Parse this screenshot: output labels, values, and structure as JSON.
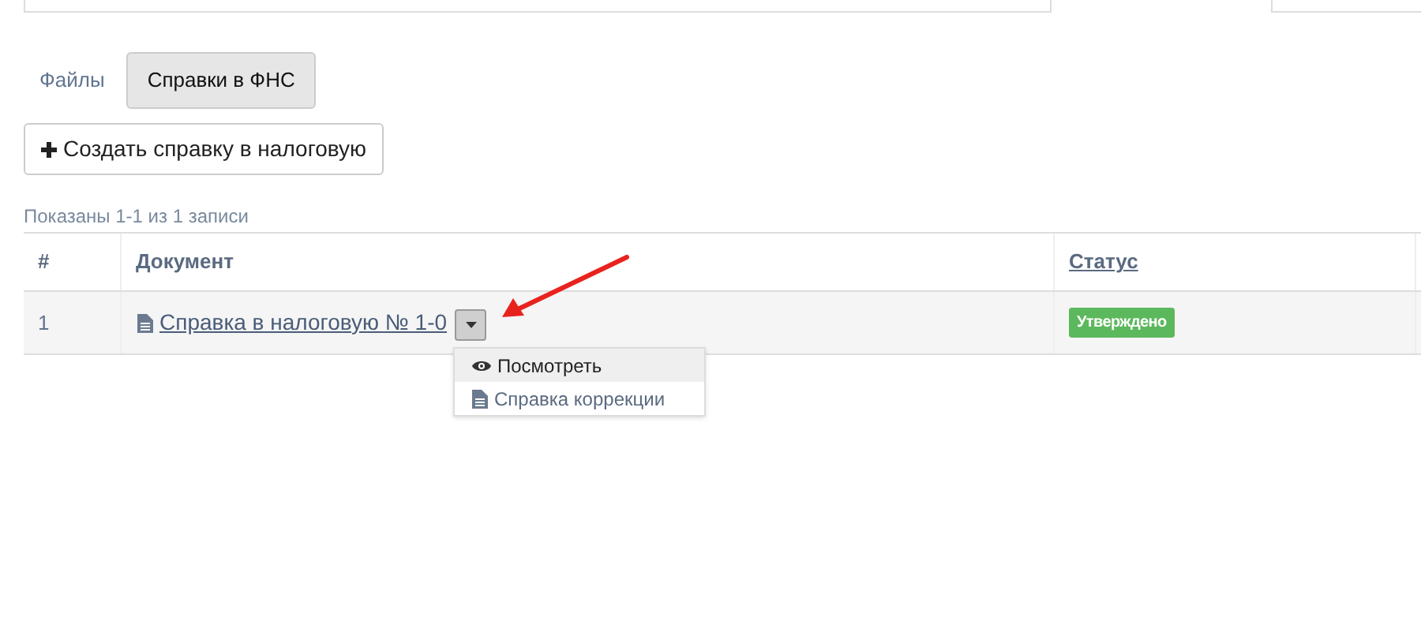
{
  "tabs": [
    {
      "label": "Файлы",
      "selected": false
    },
    {
      "label": "Справки в ФНС",
      "selected": true
    }
  ],
  "create_button": {
    "label": "Создать справку в налоговую"
  },
  "summary": "Показаны 1-1 из 1 записи",
  "table": {
    "columns": [
      {
        "label": "#",
        "sortable": false
      },
      {
        "label": "Документ",
        "sortable": false
      },
      {
        "label": "Статус",
        "sortable": true
      }
    ],
    "rows": [
      {
        "number": "1",
        "document": "Справка в налоговую № 1-0",
        "status": "Утверждено",
        "color": "#5cb85c"
      }
    ]
  },
  "dropdown": {
    "items": [
      {
        "kind": "view",
        "label": "Посмотреть",
        "selected": true
      },
      {
        "kind": "document",
        "label": "Справка коррекции",
        "selected": false
      }
    ]
  }
}
